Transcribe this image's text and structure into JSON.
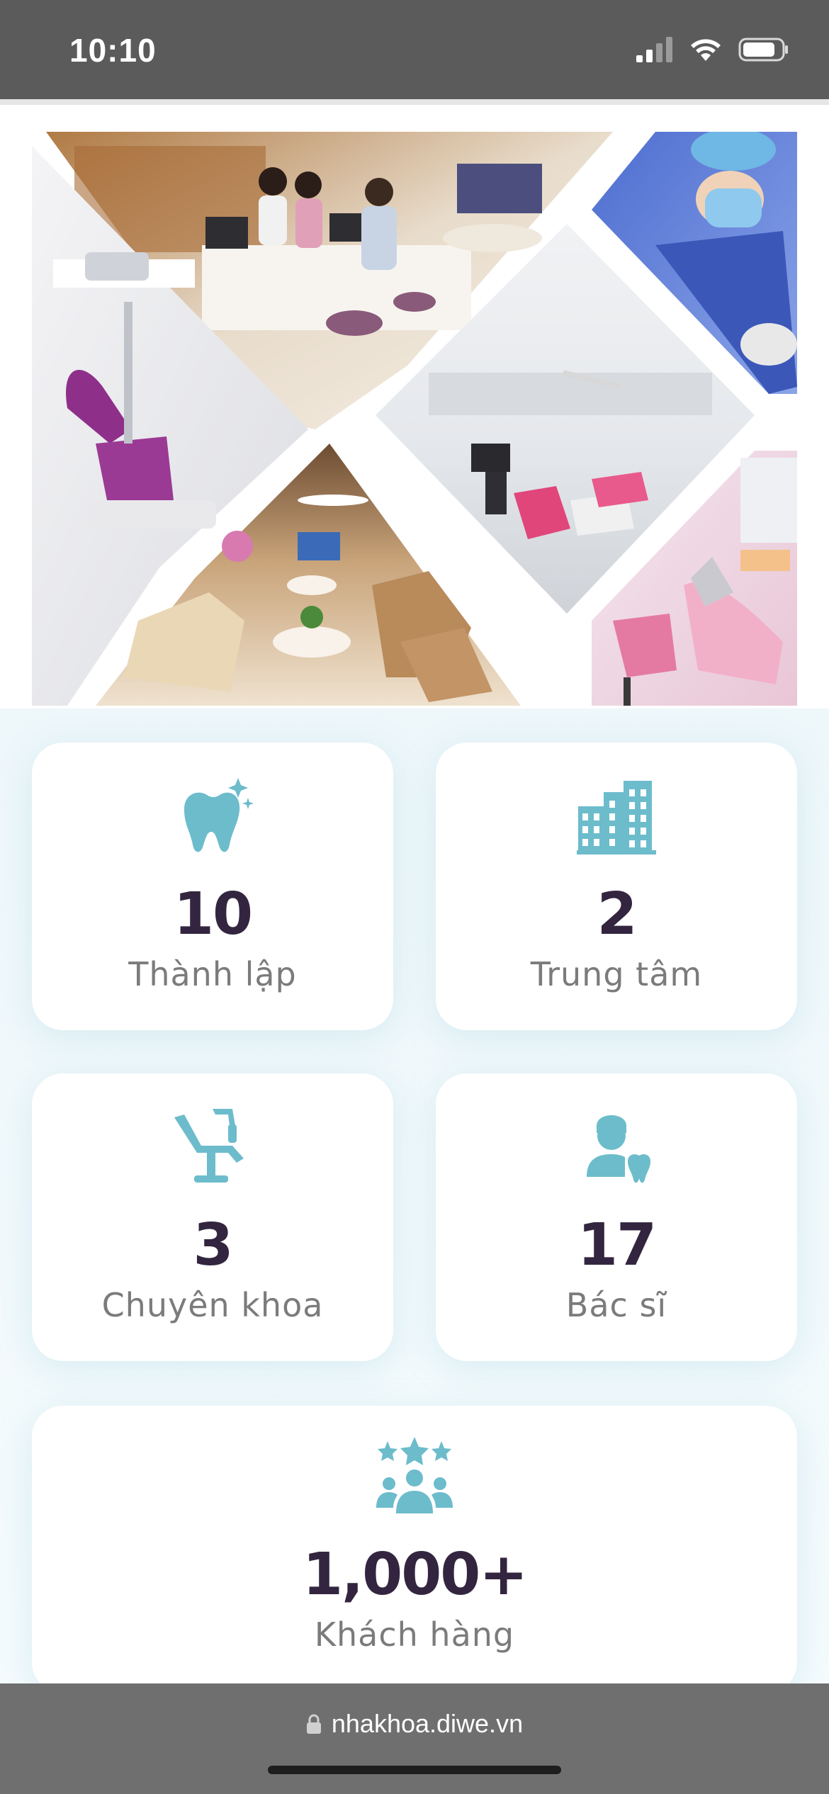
{
  "status_bar": {
    "time": "10:10"
  },
  "collage": {
    "photos": [
      "reception-desk-photo",
      "dental-chair-purple-photo",
      "surgeon-photo",
      "treatment-room-photo",
      "waiting-lounge-photo",
      "kids-treatment-room-photo"
    ]
  },
  "stats": [
    {
      "icon": "tooth-sparkle-icon",
      "value": "10",
      "label": "Thành lập"
    },
    {
      "icon": "buildings-icon",
      "value": "2",
      "label": "Trung tâm"
    },
    {
      "icon": "dental-chair-icon",
      "value": "3",
      "label": "Chuyên khoa"
    },
    {
      "icon": "dentist-icon",
      "value": "17",
      "label": "Bác sĩ"
    },
    {
      "icon": "customers-stars-icon",
      "value": "1,000+",
      "label": "Khách hàng"
    }
  ],
  "url_bar": {
    "url": "nhakhoa.diwe.vn"
  },
  "colors": {
    "accent_icon": "#6cbccc",
    "value_text": "#33253f",
    "label_text": "#7b7b7b",
    "status_bar": "#5b5b5b",
    "url_bar": "#6f6f6f"
  }
}
